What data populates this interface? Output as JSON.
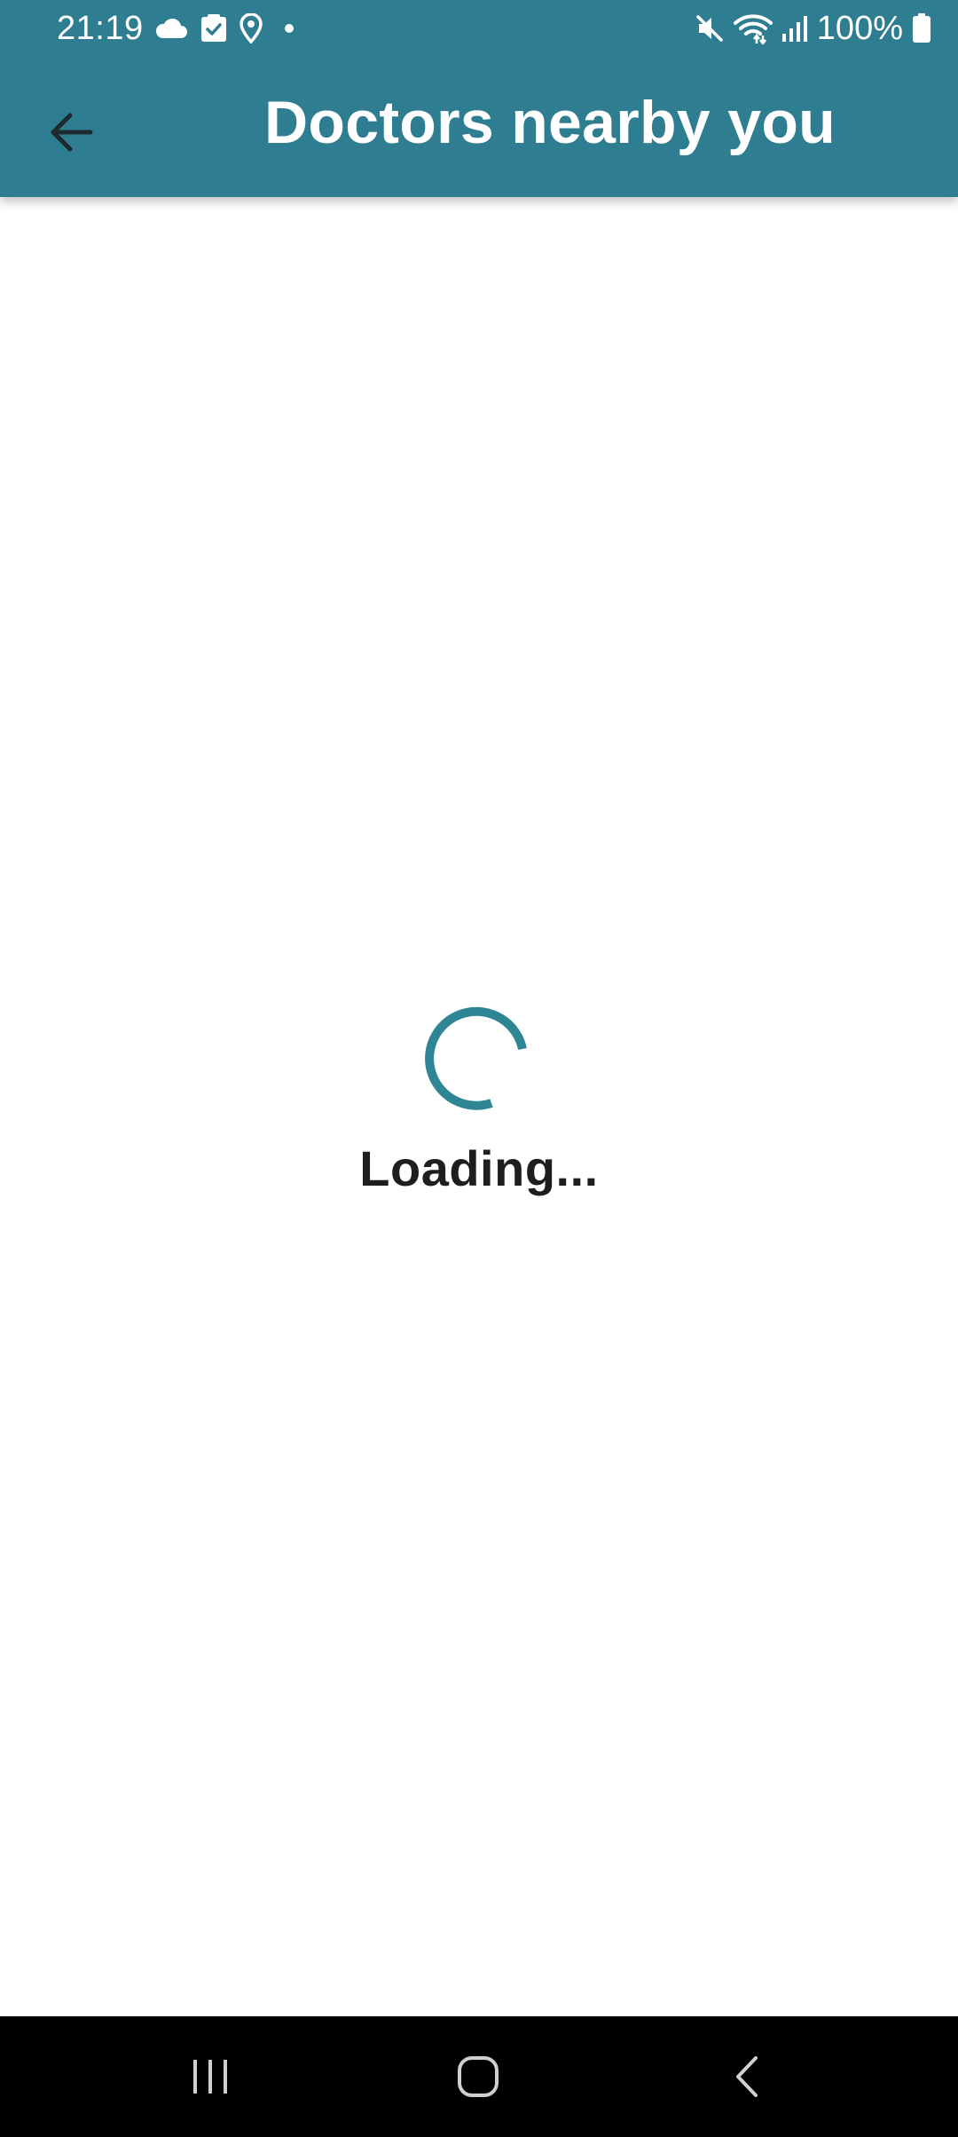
{
  "status_bar": {
    "time": "21:19",
    "battery": "100%",
    "left_icons": [
      "cloud-icon",
      "check-square-icon",
      "location-pin-icon",
      "dot-icon"
    ],
    "right_icons": [
      "mute-icon",
      "wifi-icon",
      "signal-icon",
      "battery-icon"
    ]
  },
  "app_bar": {
    "title": "Doctors nearby you",
    "back_icon": "arrow-back-icon"
  },
  "content": {
    "loading_text": "Loading..."
  },
  "nav_bar": {
    "buttons": [
      "recent-apps-icon",
      "home-icon",
      "back-icon"
    ]
  },
  "colors": {
    "primary": "#2e7d91",
    "spinner": "#2e8594",
    "text_dark": "#1e1e1e",
    "nav_background": "#000000"
  }
}
